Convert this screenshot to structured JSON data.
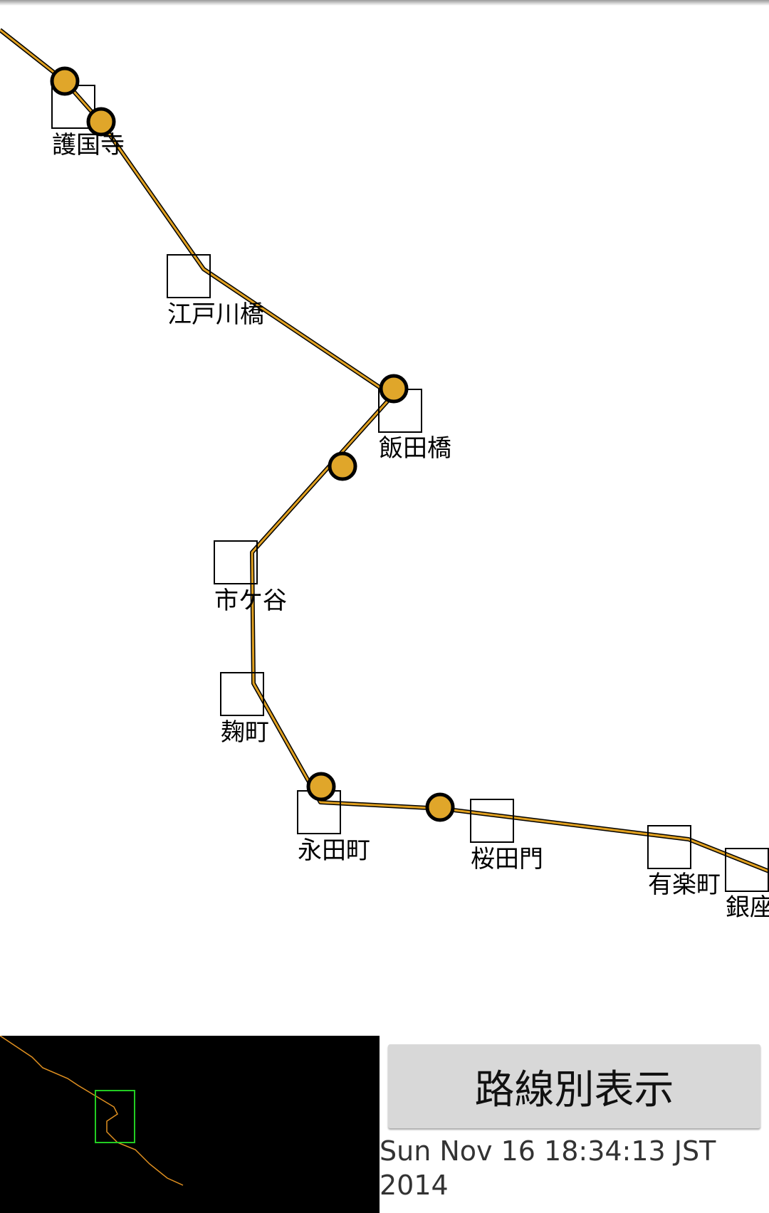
{
  "colors": {
    "line": "#e0a020",
    "line_outline": "#000000",
    "train": "#e0a62a",
    "minimap_bg": "#000000",
    "minimap_line": "#e09020",
    "minimap_view": "#22cc22",
    "button_bg": "#d8d8d8"
  },
  "stations": [
    {
      "name": "護国寺",
      "has_train": true
    },
    {
      "name": "江戸川橋",
      "has_train": false
    },
    {
      "name": "飯田橋",
      "has_train": true
    },
    {
      "name": "市ケ谷",
      "has_train": false
    },
    {
      "name": "麹町",
      "has_train": false
    },
    {
      "name": "永田町",
      "has_train": true
    },
    {
      "name": "桜田門",
      "has_train": false
    },
    {
      "name": "有楽町",
      "has_train": false
    },
    {
      "name": "銀座",
      "has_train": false
    }
  ],
  "trains_count": 6,
  "route_button": {
    "label": "路線別表示"
  },
  "timestamp": "Sun Nov 16 18:34:13 JST 2014",
  "icons": {
    "train_marker": "circle-icon",
    "station_marker": "square-icon"
  }
}
